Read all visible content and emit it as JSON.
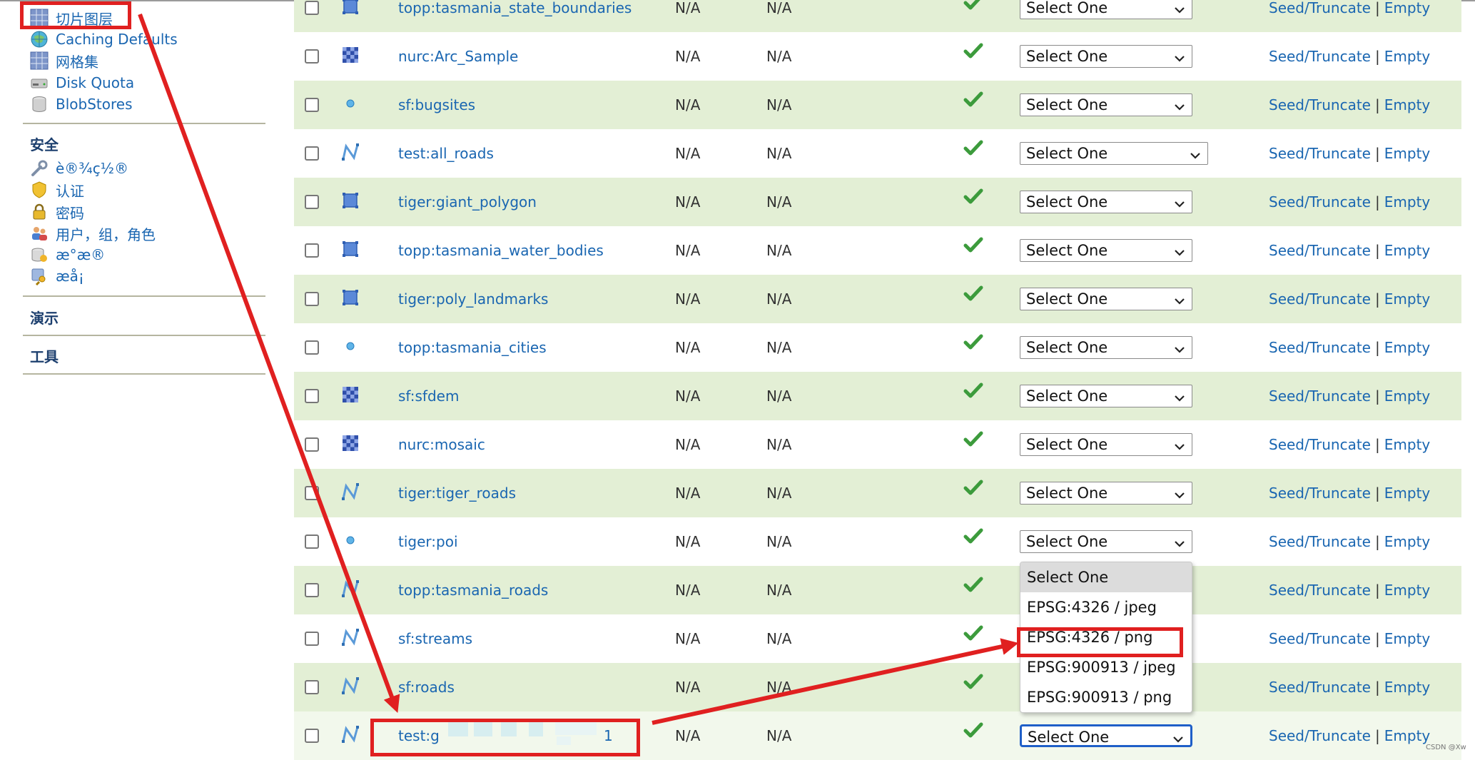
{
  "colors": {
    "link": "#1a66b1",
    "row_green": "#e3efd5",
    "annotation_red": "#e02020",
    "focus_blue": "#1f5fc8",
    "check_green": "#3c9b3c"
  },
  "sidebar": {
    "caching_items": [
      {
        "label": "切片图层",
        "icon": "layers-grid-icon"
      },
      {
        "label": "Caching Defaults",
        "icon": "globe-icon"
      },
      {
        "label": "网格集",
        "icon": "grid-icon"
      },
      {
        "label": "Disk Quota",
        "icon": "disk-icon"
      },
      {
        "label": "BlobStores",
        "icon": "database-icon"
      }
    ],
    "security_title": "安全",
    "security_items": [
      {
        "label": "è®¾ç½®",
        "icon": "wrench-icon"
      },
      {
        "label": "认证",
        "icon": "shield-icon"
      },
      {
        "label": "密码",
        "icon": "lock-icon"
      },
      {
        "label": "用户，组，角色",
        "icon": "users-icon"
      },
      {
        "label": "æ°æ®",
        "icon": "data-icon"
      },
      {
        "label": "æå¡",
        "icon": "service-key-icon"
      }
    ],
    "demo_title": "演示",
    "tools_title": "工具"
  },
  "table": {
    "action_seed": "Seed/Truncate",
    "action_empty": "Empty",
    "rows": [
      {
        "name": "topp:tasmania_state_boundaries",
        "icon": "polygon-icon",
        "col1": "N/A",
        "col2": "N/A",
        "select": "Select One"
      },
      {
        "name": "nurc:Arc_Sample",
        "icon": "raster-icon",
        "col1": "N/A",
        "col2": "N/A",
        "select": "Select One"
      },
      {
        "name": "sf:bugsites",
        "icon": "point-icon",
        "col1": "N/A",
        "col2": "N/A",
        "select": "Select One"
      },
      {
        "name": "test:all_roads",
        "icon": "line-icon",
        "col1": "N/A",
        "col2": "N/A",
        "select": "Select One"
      },
      {
        "name": "tiger:giant_polygon",
        "icon": "polygon-icon",
        "col1": "N/A",
        "col2": "N/A",
        "select": "Select One"
      },
      {
        "name": "topp:tasmania_water_bodies",
        "icon": "polygon-icon",
        "col1": "N/A",
        "col2": "N/A",
        "select": "Select One"
      },
      {
        "name": "tiger:poly_landmarks",
        "icon": "polygon-icon",
        "col1": "N/A",
        "col2": "N/A",
        "select": "Select One"
      },
      {
        "name": "topp:tasmania_cities",
        "icon": "point-icon",
        "col1": "N/A",
        "col2": "N/A",
        "select": "Select One"
      },
      {
        "name": "sf:sfdem",
        "icon": "raster-icon",
        "col1": "N/A",
        "col2": "N/A",
        "select": "Select One"
      },
      {
        "name": "nurc:mosaic",
        "icon": "raster-icon",
        "col1": "N/A",
        "col2": "N/A",
        "select": "Select One"
      },
      {
        "name": "tiger:tiger_roads",
        "icon": "line-icon",
        "col1": "N/A",
        "col2": "N/A",
        "select": "Select One"
      },
      {
        "name": "tiger:poi",
        "icon": "point-icon",
        "col1": "N/A",
        "col2": "N/A",
        "select": "Select One"
      },
      {
        "name": "topp:tasmania_roads",
        "icon": "line-icon",
        "col1": "N/A",
        "col2": "N/A",
        "select": ""
      },
      {
        "name": "sf:streams",
        "icon": "line-icon",
        "col1": "N/A",
        "col2": "N/A",
        "select": ""
      },
      {
        "name": "sf:roads",
        "icon": "line-icon",
        "col1": "N/A",
        "col2": "N/A",
        "select": ""
      },
      {
        "name": "test:g",
        "name_suffix": "1",
        "icon": "line-icon",
        "col1": "N/A",
        "col2": "N/A",
        "select": "Select One"
      }
    ]
  },
  "dropdown": {
    "options": [
      "Select One",
      "EPSG:4326 / jpeg",
      "EPSG:4326 / png",
      "EPSG:900913 / jpeg",
      "EPSG:900913 / png"
    ],
    "highlighted": "Select One",
    "annotated": "EPSG:4326 / png"
  },
  "watermark": "CSDN @Xw"
}
